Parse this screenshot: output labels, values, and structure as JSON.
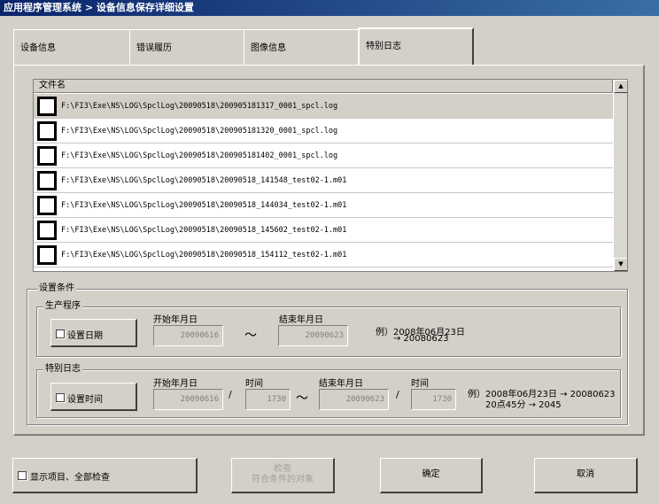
{
  "window": {
    "title": "应用程序管理系统 > 设备信息保存详细设置"
  },
  "tabs": [
    {
      "label": "设备信息"
    },
    {
      "label": "错误履历"
    },
    {
      "label": "图像信息"
    },
    {
      "label": "特别日志"
    }
  ],
  "list": {
    "header": "文件名",
    "rows": [
      "F:\\FI3\\Exe\\NS\\LOG\\SpclLog\\20090518\\200905181317_0001_spcl.log",
      "F:\\FI3\\Exe\\NS\\LOG\\SpclLog\\20090518\\200905181320_0001_spcl.log",
      "F:\\FI3\\Exe\\NS\\LOG\\SpclLog\\20090518\\200905181402_0001_spcl.log",
      "F:\\FI3\\Exe\\NS\\LOG\\SpclLog\\20090518\\20090518_141548_test02-1.m01",
      "F:\\FI3\\Exe\\NS\\LOG\\SpclLog\\20090518\\20090518_144034_test02-1.m01",
      "F:\\FI3\\Exe\\NS\\LOG\\SpclLog\\20090518\\20090518_145602_test02-1.m01",
      "F:\\FI3\\Exe\\NS\\LOG\\SpclLog\\20090518\\20090518_154112_test02-1.m01"
    ]
  },
  "conditions": {
    "label": "设置条件",
    "production": {
      "label": "生产程序",
      "checkbox_label": "设置日期",
      "start_label": "开始年月日",
      "start_value": "20090616",
      "range_sep": "～",
      "end_label": "结束年月日",
      "end_value": "20090623",
      "example_line1": "例）2008年06月23日",
      "example_line2": "→ 20080623"
    },
    "special": {
      "label": "特别日志",
      "checkbox_label": "设置时间",
      "start_label": "开始年月日",
      "start_value": "20090616",
      "slash": "/",
      "time_label": "时间",
      "start_time": "1730",
      "range_sep": "～",
      "end_label": "结束年月日",
      "end_value": "20090623",
      "end_time_label": "时间",
      "end_time": "1730",
      "example_line1": "例）2008年06月23日 → 20080623",
      "example_line2": "20点45分 → 2045"
    }
  },
  "bottom": {
    "show_all_label": "显示项目、全部检查",
    "search_line1": "检查",
    "search_line2": "符合条件的对象",
    "ok_label": "确定",
    "cancel_label": "取消"
  }
}
